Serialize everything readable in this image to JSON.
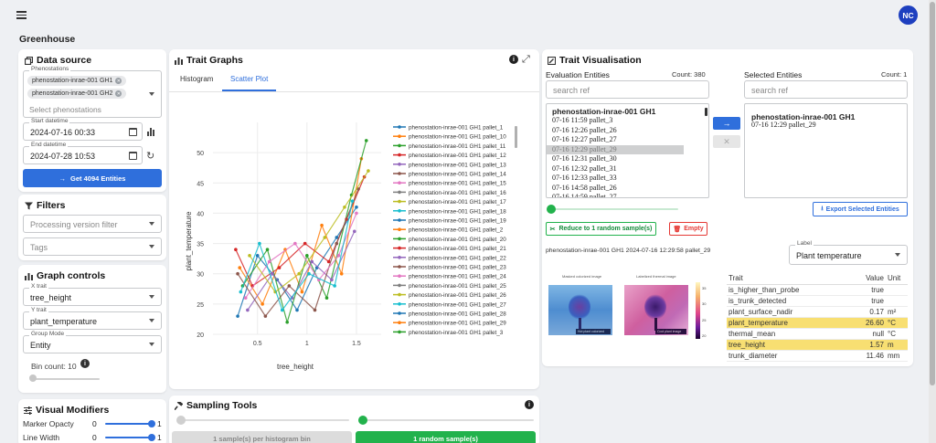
{
  "appbar": {
    "menu_icon": "hamburger-menu-icon",
    "avatar": "NC"
  },
  "page_title": "Greenhouse",
  "data_source": {
    "title": "Data source",
    "phenostations_label": "Phenostations",
    "chips": [
      "phenostation-inrae-001 GH1",
      "phenostation-inrae-001 GH2"
    ],
    "select_placeholder": "Select phenostations",
    "start_label": "Start datetime",
    "start_value": "2024-07-16 00:33",
    "end_label": "End datetime",
    "end_value": "2024-07-28 10:53",
    "get_button": "Get 4094 Entities"
  },
  "filters": {
    "title": "Filters",
    "processing_placeholder": "Processing version filter",
    "tags_placeholder": "Tags"
  },
  "graph_controls": {
    "title": "Graph controls",
    "x_label": "X trait",
    "x_value": "tree_height",
    "y_label": "Y trait",
    "y_value": "plant_temperature",
    "group_label": "Group Mode",
    "group_value": "Entity",
    "bin_label": "Bin count: 10"
  },
  "visual_modifiers": {
    "title": "Visual Modifiers",
    "marker_label": "Marker Opacty",
    "marker_min": "0",
    "marker_max": "1",
    "marker_value": 1,
    "line_label": "Line Width",
    "line_min": "0",
    "line_max": "1",
    "line_value": 1
  },
  "trait_graphs": {
    "title": "Trait Graphs",
    "tabs": [
      "Histogram",
      "Scatter Plot"
    ],
    "active_tab": "Scatter Plot"
  },
  "chart_data": {
    "type": "scatter",
    "title": "",
    "xlabel": "tree_height",
    "ylabel": "plant_temperature",
    "xlim": [
      0.05,
      1.75
    ],
    "ylim": [
      20,
      55
    ],
    "xticks": [
      0.5,
      1,
      1.5
    ],
    "yticks": [
      20,
      25,
      30,
      35,
      40,
      45,
      50
    ],
    "grid": true,
    "legend_position": "right",
    "series": [
      {
        "name": "phenostation-inrae-001 GH1 pallet_1",
        "color": "#1f77b4"
      },
      {
        "name": "phenostation-inrae-001 GH1 pallet_10",
        "color": "#ff7f0e"
      },
      {
        "name": "phenostation-inrae-001 GH1 pallet_11",
        "color": "#2ca02c"
      },
      {
        "name": "phenostation-inrae-001 GH1 pallet_12",
        "color": "#d62728"
      },
      {
        "name": "phenostation-inrae-001 GH1 pallet_13",
        "color": "#9467bd"
      },
      {
        "name": "phenostation-inrae-001 GH1 pallet_14",
        "color": "#8c564b"
      },
      {
        "name": "phenostation-inrae-001 GH1 pallet_15",
        "color": "#e377c2"
      },
      {
        "name": "phenostation-inrae-001 GH1 pallet_16",
        "color": "#7f7f7f"
      },
      {
        "name": "phenostation-inrae-001 GH1 pallet_17",
        "color": "#bcbd22"
      },
      {
        "name": "phenostation-inrae-001 GH1 pallet_18",
        "color": "#17becf"
      },
      {
        "name": "phenostation-inrae-001 GH1 pallet_19",
        "color": "#1f77b4"
      },
      {
        "name": "phenostation-inrae-001 GH1 pallet_2",
        "color": "#ff7f0e"
      },
      {
        "name": "phenostation-inrae-001 GH1 pallet_20",
        "color": "#2ca02c"
      },
      {
        "name": "phenostation-inrae-001 GH1 pallet_21",
        "color": "#d62728"
      },
      {
        "name": "phenostation-inrae-001 GH1 pallet_22",
        "color": "#9467bd"
      },
      {
        "name": "phenostation-inrae-001 GH1 pallet_23",
        "color": "#8c564b"
      },
      {
        "name": "phenostation-inrae-001 GH1 pallet_24",
        "color": "#e377c2"
      },
      {
        "name": "phenostation-inrae-001 GH1 pallet_25",
        "color": "#7f7f7f"
      },
      {
        "name": "phenostation-inrae-001 GH1 pallet_26",
        "color": "#bcbd22"
      },
      {
        "name": "phenostation-inrae-001 GH1 pallet_27",
        "color": "#17becf"
      },
      {
        "name": "phenostation-inrae-001 GH1 pallet_28",
        "color": "#1f77b4"
      },
      {
        "name": "phenostation-inrae-001 GH1 pallet_29",
        "color": "#ff7f0e"
      },
      {
        "name": "phenostation-inrae-001 GH1 pallet_3",
        "color": "#2ca02c"
      }
    ],
    "point_clouds": [
      {
        "color": "#1f77b4",
        "x": [
          0.3,
          0.5,
          0.7,
          0.9,
          1.1,
          1.3,
          1.5
        ],
        "y": [
          23,
          33,
          29,
          24,
          31,
          36,
          41
        ]
      },
      {
        "color": "#ff7f0e",
        "x": [
          0.32,
          0.55,
          0.78,
          0.95,
          1.15,
          1.35,
          1.55
        ],
        "y": [
          31,
          25,
          34,
          27,
          38,
          30,
          49
        ]
      },
      {
        "color": "#2ca02c",
        "x": [
          0.35,
          0.6,
          0.8,
          1.0,
          1.2,
          1.45,
          1.6
        ],
        "y": [
          28,
          34,
          22,
          33,
          26,
          43,
          52
        ]
      },
      {
        "color": "#d62728",
        "x": [
          0.28,
          0.45,
          0.72,
          0.98,
          1.22,
          1.4,
          1.58
        ],
        "y": [
          34,
          28,
          31,
          35,
          32,
          39,
          46
        ]
      },
      {
        "color": "#9467bd",
        "x": [
          0.4,
          0.65,
          0.85,
          1.05,
          1.25,
          1.48
        ],
        "y": [
          24,
          30,
          26,
          32,
          29,
          37
        ]
      },
      {
        "color": "#8c564b",
        "x": [
          0.3,
          0.58,
          0.82,
          1.08,
          1.3,
          1.52
        ],
        "y": [
          30,
          23,
          28,
          24,
          35,
          44
        ]
      },
      {
        "color": "#e377c2",
        "x": [
          0.38,
          0.62,
          0.88,
          1.12,
          1.32,
          1.5
        ],
        "y": [
          26,
          32,
          35,
          29,
          33,
          40
        ]
      },
      {
        "color": "#bcbd22",
        "x": [
          0.42,
          0.68,
          0.92,
          1.18,
          1.38,
          1.62
        ],
        "y": [
          33,
          27,
          30,
          36,
          41,
          47
        ]
      },
      {
        "color": "#17becf",
        "x": [
          0.33,
          0.52,
          0.75,
          1.02,
          1.28,
          1.46
        ],
        "y": [
          27,
          35,
          24,
          30,
          28,
          42
        ]
      }
    ]
  },
  "sampling": {
    "title": "Sampling Tools",
    "btn_hist": "1 sample(s) per histogram bin",
    "btn_random": "1 random sample(s)"
  },
  "trait_vis": {
    "title": "Trait Visualisation",
    "eval_label": "Evaluation Entities",
    "eval_count": "Count: 380",
    "sel_label": "Selected Entities",
    "sel_count": "Count: 1",
    "search_placeholder": "search ref",
    "eval_group": "phenostation-inrae-001 GH1",
    "eval_items": [
      "07-16 11:59 pallet_3",
      "07-16 12:26 pallet_26",
      "07-16 12:27 pallet_27",
      "07-16 12:29 pallet_29",
      "07-16 12:31 pallet_30",
      "07-16 12:32 pallet_31",
      "07-16 12:33 pallet_33",
      "07-16 14:58 pallet_26",
      "07-16 14:59 pallet_27"
    ],
    "eval_selected_index": 3,
    "sel_group": "phenostation-inrae-001 GH1",
    "sel_items": [
      "07-16 12:29 pallet_29"
    ],
    "reduce_btn": "Reduce to 1 random sample(s)",
    "empty_btn": "Empty",
    "export_btn": "Export Selected Entities",
    "entity_caption": "phenostation-inrae-001 GH1 2024-07-16 12:29:58 pallet_29",
    "trait_label": "Label",
    "trait_value": "Plant temperature",
    "img1_caption": "Masked colorized image",
    "img2_caption": "Labelized thermal image",
    "img_tag1": "Hot plant colorized image",
    "img_tag2": "Cool plant image",
    "colorbar_ticks": [
      "35",
      "30",
      "25",
      "20"
    ],
    "table_headers": [
      "Trait",
      "Value",
      "Unit"
    ],
    "rows": [
      {
        "trait": "is_higher_than_probe",
        "value": "true",
        "unit": "",
        "hl": false
      },
      {
        "trait": "is_trunk_detected",
        "value": "true",
        "unit": "",
        "hl": false
      },
      {
        "trait": "plant_surface_nadir",
        "value": "0.17",
        "unit": "m²",
        "hl": false
      },
      {
        "trait": "plant_temperature",
        "value": "26.60",
        "unit": "°C",
        "hl": true
      },
      {
        "trait": "thermal_mean",
        "value": "null",
        "unit": "°C",
        "hl": false
      },
      {
        "trait": "tree_height",
        "value": "1.57",
        "unit": "m",
        "hl": true
      },
      {
        "trait": "trunk_diameter",
        "value": "11.46",
        "unit": "mm",
        "hl": false
      }
    ]
  },
  "colors": {
    "accent": "#2f6fdc",
    "green": "#22b24c",
    "highlight": "#f8df72",
    "danger": "#e53935"
  }
}
